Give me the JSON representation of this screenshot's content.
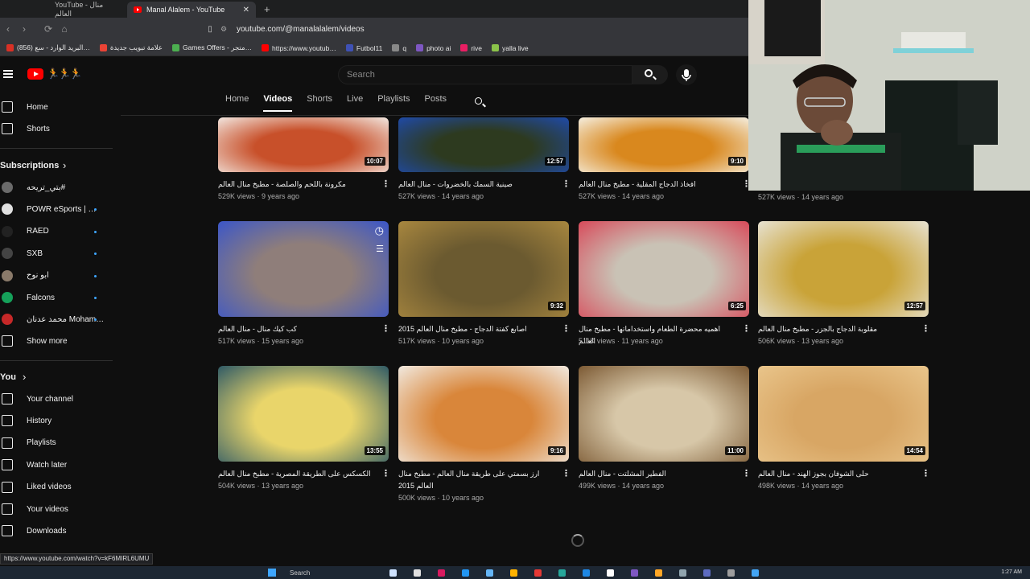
{
  "browser": {
    "tabs": [
      {
        "title": "YouTube - منال العالم",
        "active": false
      },
      {
        "title": "Manal Alalem - YouTube",
        "active": true
      }
    ],
    "new_tab": "+",
    "url": "youtube.com/@manalalalem/videos",
    "bookmarks": [
      {
        "label": "(856) البريد الوارد - سع…",
        "color": "#d93025"
      },
      {
        "label": "علامة تبويب جديدة",
        "color": "#ea4335"
      },
      {
        "label": "Games Offers - متجر…",
        "color": "#4caf50"
      },
      {
        "label": "https://www.youtub…",
        "color": "#ff0000"
      },
      {
        "label": "Futbol11",
        "color": "#3f51b5"
      },
      {
        "label": "q",
        "color": "#888888"
      },
      {
        "label": "photo ai",
        "color": "#7e57c2"
      },
      {
        "label": "rive",
        "color": "#e91e63"
      },
      {
        "label": "yalla live",
        "color": "#8bc34a"
      }
    ],
    "status_url": "https://www.youtube.com/watch?v=kF6MIRL6UMU"
  },
  "header": {
    "search_placeholder": "Search",
    "logo_doodle": "🏃🏃🏃"
  },
  "sidebar": {
    "main": [
      {
        "label": "Home",
        "icon": "home-icon"
      },
      {
        "label": "Shorts",
        "icon": "shorts-icon"
      }
    ],
    "subscriptions_title": "Subscriptions",
    "subscriptions": [
      {
        "label": "بتي_تريحه#",
        "color": "#6b6b6b",
        "dot": false
      },
      {
        "label": "POWR eSports | …",
        "color": "#e0e0e0",
        "dot": true
      },
      {
        "label": "RAED",
        "color": "#222222",
        "dot": true
      },
      {
        "label": "SXB",
        "color": "#444444",
        "dot": true
      },
      {
        "label": "ابو نوح",
        "color": "#8a7a6a",
        "dot": true
      },
      {
        "label": "Falcons",
        "color": "#15a15a",
        "dot": true
      },
      {
        "label": "محمد عدنان Moham…",
        "color": "#c62828",
        "dot": true
      }
    ],
    "show_more": "Show more",
    "you_title": "You",
    "you": [
      {
        "label": "Your channel",
        "icon": "channel-icon"
      },
      {
        "label": "History",
        "icon": "history-icon"
      },
      {
        "label": "Playlists",
        "icon": "playlists-icon"
      },
      {
        "label": "Watch later",
        "icon": "watch-later-icon"
      },
      {
        "label": "Liked videos",
        "icon": "like-icon"
      },
      {
        "label": "Your videos",
        "icon": "your-videos-icon"
      },
      {
        "label": "Downloads",
        "icon": "download-icon"
      }
    ]
  },
  "channel_tabs": [
    "Home",
    "Videos",
    "Shorts",
    "Live",
    "Playlists",
    "Posts"
  ],
  "active_channel_tab": "Videos",
  "videos": [
    {
      "title": "مكرونة باللحم والصلصة - مطبخ منال العالم",
      "meta": "529K views · 9 years ago",
      "duration": "10:07",
      "colors": [
        "#c8502a",
        "#f2e7e0"
      ]
    },
    {
      "title": "صينية السمك بالخضروات - منال العالم",
      "meta": "527K views · 14 years ago",
      "duration": "12:57",
      "colors": [
        "#2d3a1f",
        "#1f4aa8"
      ]
    },
    {
      "title": "افخاذ الدجاج المقلية - مطبخ منال العالم",
      "meta": "527K views · 14 years ago",
      "duration": "9:10",
      "colors": [
        "#d9881e",
        "#f5efe0"
      ]
    },
    {
      "title": "",
      "meta": "527K views · 14 years ago",
      "duration": "",
      "colors": [
        "#000000",
        "#000000"
      ]
    },
    {
      "title": "كب كيك منال - منال العالم",
      "meta": "517K views · 15 years ago",
      "duration": "",
      "colors": [
        "#8f7e7a",
        "#3b56c8"
      ]
    },
    {
      "title": "اصابع كفتة الدجاج - مطبخ منال العالم 2015",
      "meta": "517K views · 10 years ago",
      "duration": "9:32",
      "colors": [
        "#6b5a30",
        "#a8873f"
      ]
    },
    {
      "title": "اهميه محضرة الطعام واستخداماتها - مطبخ منال العالم",
      "meta": "511K views · 11 years ago",
      "duration": "6:25",
      "colors": [
        "#c9c2b5",
        "#d84a5a"
      ]
    },
    {
      "title": "مقلوبة الدجاج بالجزر - مطبخ منال العالم",
      "meta": "506K views · 13 years ago",
      "duration": "12:57",
      "colors": [
        "#c9a338",
        "#e7e2d2"
      ]
    },
    {
      "title": "الكسكس على الطريقة المصرية - مطبخ منال العالم",
      "meta": "504K views · 13 years ago",
      "duration": "13:55",
      "colors": [
        "#e9d56a",
        "#2f5a66"
      ]
    },
    {
      "title": "ارز بسمتي على طريقة منال العالم - مطبخ منال العالم 2015",
      "meta": "500K views · 10 years ago",
      "duration": "9:16",
      "colors": [
        "#d9863a",
        "#f1e9df"
      ]
    },
    {
      "title": "الفطير المشلتت - منال العالم",
      "meta": "499K views · 14 years ago",
      "duration": "11:00",
      "colors": [
        "#d7c7a8",
        "#7c5a34"
      ]
    },
    {
      "title": "حلى الشوفان بجوز الهند - منال العالم",
      "meta": "498K views · 14 years ago",
      "duration": "14:54",
      "colors": [
        "#d8a664",
        "#e9c58b"
      ]
    }
  ],
  "taskbar": {
    "search_label": "Search",
    "clock": "1:27 AM"
  }
}
